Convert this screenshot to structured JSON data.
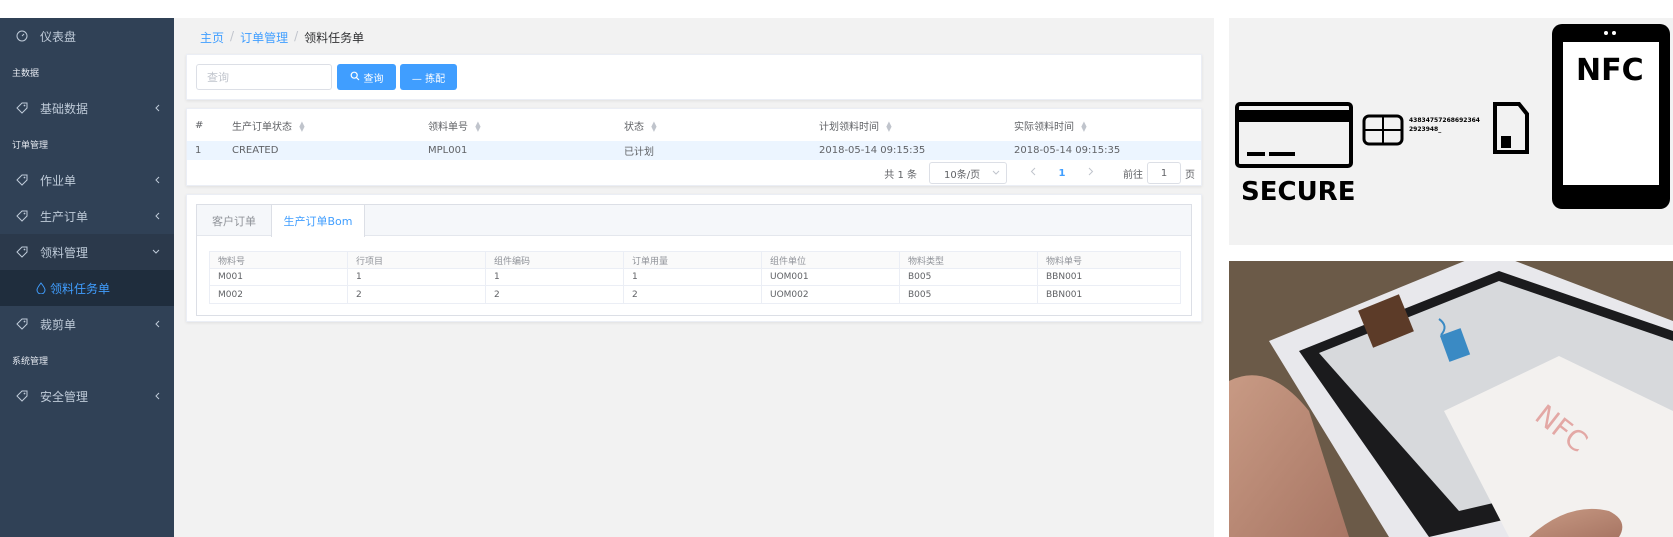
{
  "sidebar": {
    "dashboard": "仪表盘",
    "group_master": "主数据",
    "basic_data": "基础数据",
    "group_order": "订单管理",
    "work_order": "作业单",
    "production_order": "生产订单",
    "material_mgmt": "领料管理",
    "material_task": "领料任务单",
    "cutting_order": "裁剪单",
    "group_system": "系统管理",
    "security_mgmt": "安全管理"
  },
  "breadcrumb": {
    "home": "主页",
    "order_mgmt": "订单管理",
    "current": "领料任务单",
    "sep": "/"
  },
  "toolbar": {
    "search_placeholder": "查询",
    "query_label": "查询",
    "match_label": "— 拣配"
  },
  "table": {
    "headers": [
      "#",
      "生产订单状态",
      "领料单号",
      "状态",
      "计划领料时间",
      "实际领料时间"
    ],
    "rows": [
      [
        "1",
        "CREATED",
        "MPL001",
        "已计划",
        "2018-05-14 09:15:35",
        "2018-05-14 09:15:35"
      ]
    ]
  },
  "pager": {
    "total": "共 1 条",
    "page_size": "10条/页",
    "current_page": "1",
    "goto": "前往",
    "jump_value": "1",
    "unit": "页"
  },
  "detail_tabs": {
    "tab_customer": "客户订单",
    "tab_bom": "生产订单Bom"
  },
  "bom_table": {
    "headers": [
      "物料号",
      "行项目",
      "组件编码",
      "订单用量",
      "组件单位",
      "物料类型",
      "物料单号"
    ],
    "rows": [
      [
        "M001",
        "1",
        "1",
        "1",
        "UOM001",
        "B005",
        "BBN001"
      ],
      [
        "M002",
        "2",
        "2",
        "2",
        "UOM002",
        "B005",
        "BBN001"
      ]
    ]
  },
  "nfc_banner": {
    "secure": "SECURE",
    "nfc": "NFC",
    "card_number": "43834757268692364\n2923948_"
  },
  "nfc_photo": {
    "card_text": "NFC"
  },
  "colors": {
    "sidebar_bg": "#304156",
    "accent": "#409eff"
  }
}
